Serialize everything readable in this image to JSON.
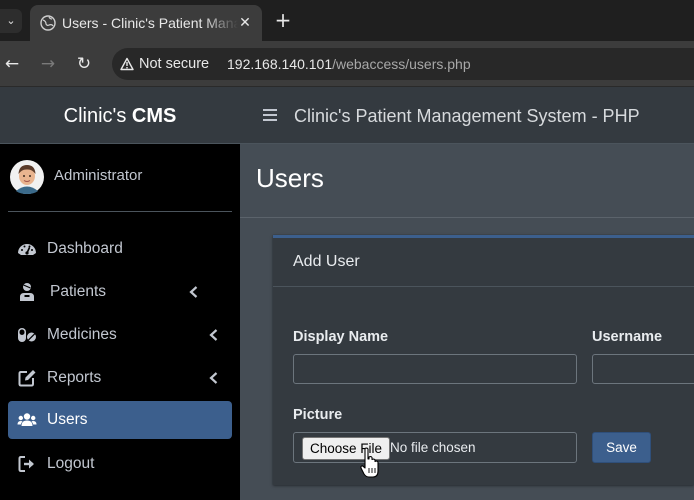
{
  "browser": {
    "tab_title": "Users - Clinic's Patient Management System - PHP",
    "close_glyph": "✕",
    "newtab_glyph": "+",
    "dropdown_glyph": "⌄",
    "nav": {
      "back_glyph": "←",
      "forward_glyph": "→",
      "reload_glyph": "↻"
    },
    "security_label": "Not secure",
    "url_host": "192.168.140.101",
    "url_path": "/webaccess/users.php"
  },
  "sidebar": {
    "brand_prefix": "Clinic's ",
    "brand_strong": "CMS",
    "user_name": "Administrator",
    "items": [
      {
        "label": "Dashboard",
        "icon": "tachometer-icon",
        "has_caret": false,
        "active": false
      },
      {
        "label": "Patients",
        "icon": "user-injured-icon",
        "has_caret": true,
        "active": false
      },
      {
        "label": "Medicines",
        "icon": "pills-icon",
        "has_caret": true,
        "active": false
      },
      {
        "label": "Reports",
        "icon": "edit-icon",
        "has_caret": true,
        "active": false
      },
      {
        "label": "Users",
        "icon": "users-icon",
        "has_caret": false,
        "active": true
      },
      {
        "label": "Logout",
        "icon": "logout-icon",
        "has_caret": false,
        "active": false
      }
    ]
  },
  "header": {
    "system_title": "Clinic's Patient Management System - PHP"
  },
  "page": {
    "title": "Users"
  },
  "form": {
    "card_title": "Add User",
    "display_name_label": "Display Name",
    "display_name_value": "",
    "username_label": "Username",
    "username_value": "",
    "picture_label": "Picture",
    "choose_file_label": "Choose File",
    "file_status": "No file chosen",
    "save_label": "Save"
  },
  "colors": {
    "accent": "#3c5f8d",
    "sidebar_bg": "#000000",
    "header_bg": "#343a40",
    "content_bg": "#454d55"
  }
}
